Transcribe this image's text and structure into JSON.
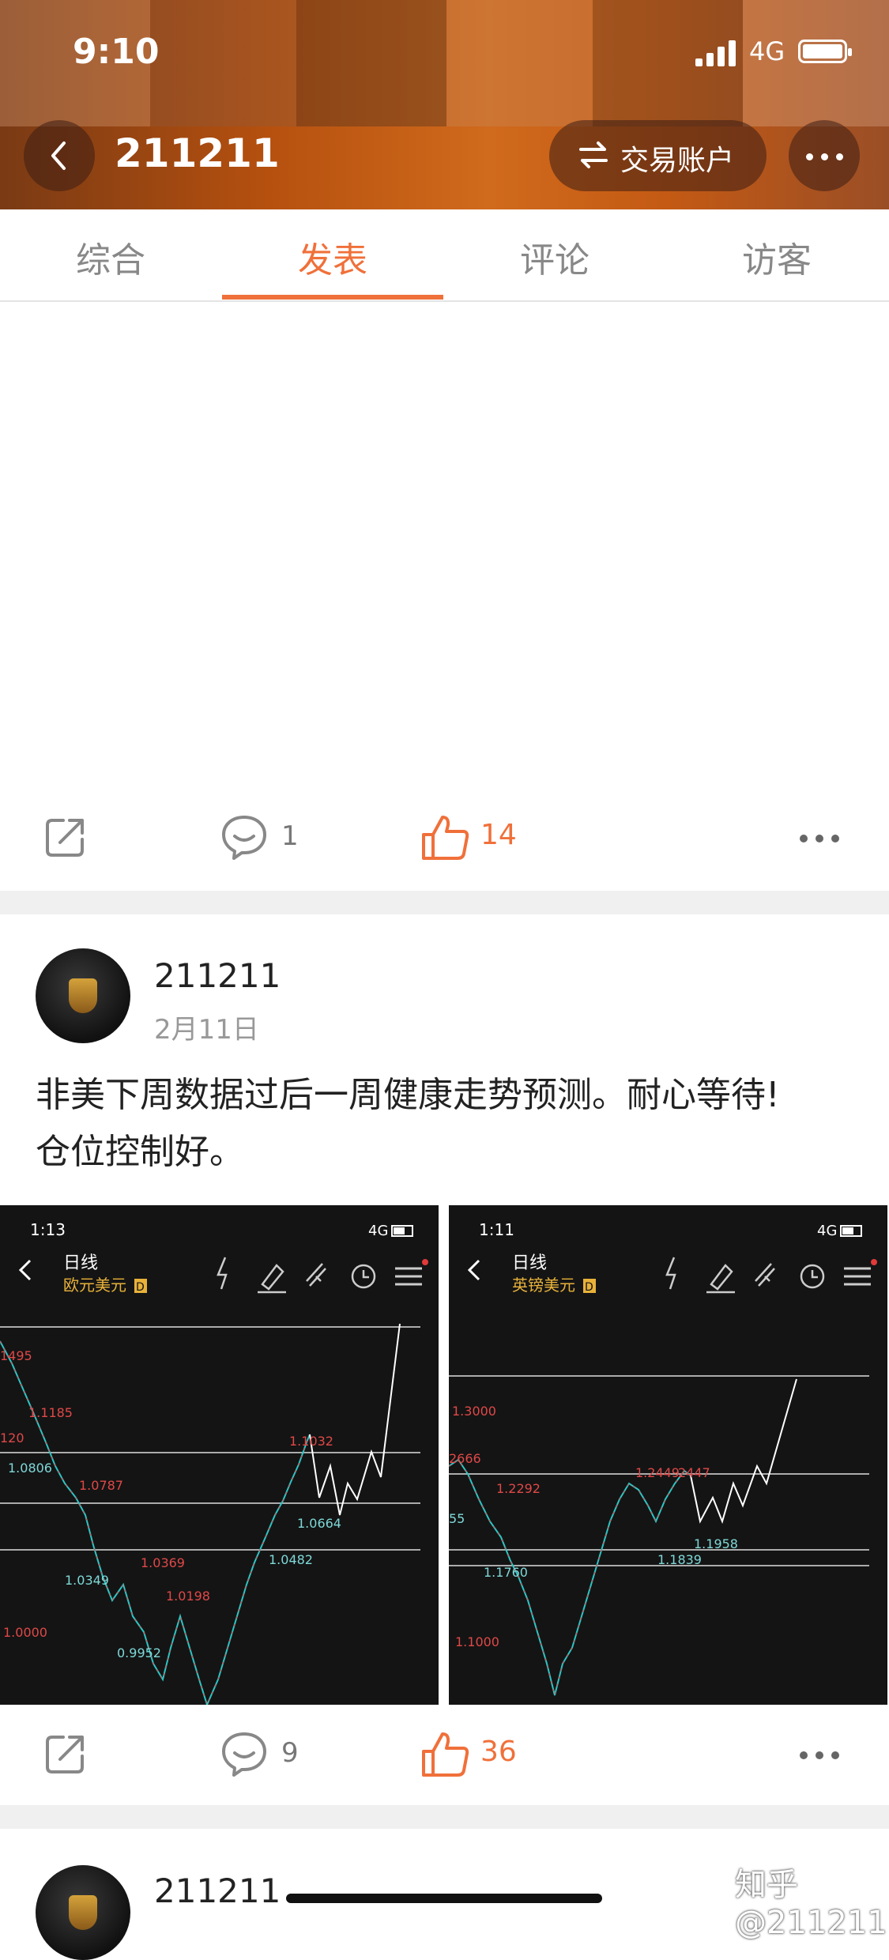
{
  "status_bar": {
    "time": "9:10",
    "network": "4G"
  },
  "header": {
    "title": "211211",
    "trade_button": "交易账户"
  },
  "tabs": [
    {
      "label": "综合"
    },
    {
      "label": "发表"
    },
    {
      "label": "评论"
    },
    {
      "label": "访客"
    }
  ],
  "active_tab": "发表",
  "posts": [
    {
      "comments": "1",
      "likes": "14"
    },
    {
      "author": "211211",
      "date": "2月11日",
      "text_line1": "非美下周数据过后一周健康走势预测。耐心等待!",
      "text_line2": "仓位控制好。",
      "comments": "9",
      "likes": "36"
    },
    {
      "author": "211211"
    }
  ],
  "charts": [
    {
      "time": "1:13",
      "network": "4G",
      "period": "日线",
      "symbol": "欧元美元",
      "badge": "D",
      "price_labels": [
        "1495",
        "1.1185",
        "120",
        "1.0806",
        "1.0787",
        "1.0349",
        "1.0369",
        "1.0198",
        "1.0000",
        "0.9952",
        "1.1032",
        "1.0664",
        "1.0482"
      ]
    },
    {
      "time": "1:11",
      "network": "4G",
      "period": "日线",
      "symbol": "英镑美元",
      "badge": "D",
      "price_labels": [
        "1.3000",
        "2666",
        "1.2292",
        "55",
        "1.1760",
        "1.2449",
        "2447",
        "1.1958",
        "1.1839",
        "1.1000"
      ]
    }
  ],
  "watermark": "知乎 @211211",
  "colors": {
    "accent": "#f0703a",
    "header_orange": "#c45a14"
  }
}
